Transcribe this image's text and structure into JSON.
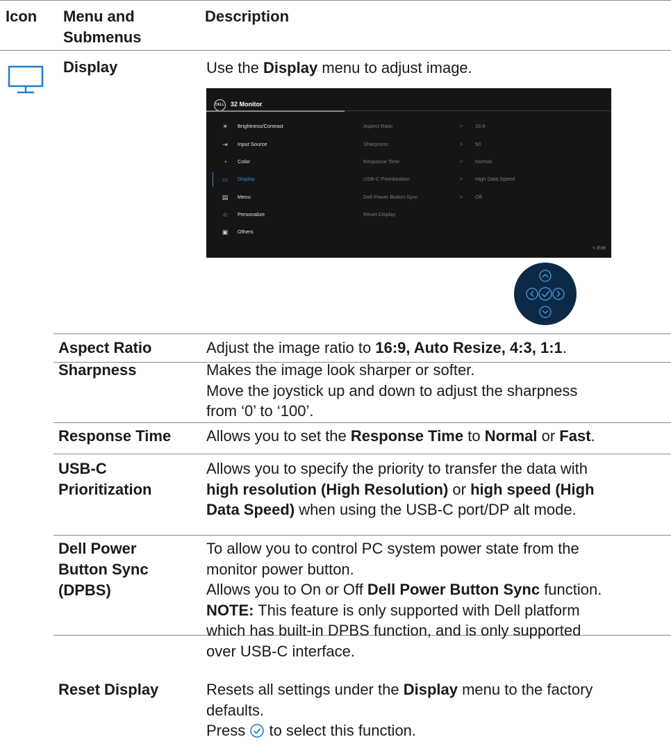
{
  "header": {
    "icon": "Icon",
    "menu_line1": "Menu and",
    "menu_line2": "Submenus",
    "description": "Description"
  },
  "main_menu": {
    "icon": "monitor-icon",
    "name": "Display",
    "desc_pre": "Use the ",
    "desc_bold": "Display",
    "desc_post": " menu to adjust image."
  },
  "osd": {
    "brand": "DELL",
    "title": "32 Monitor",
    "menu_items": [
      {
        "label": "Brightness/Contrast",
        "icon": "brightness-icon"
      },
      {
        "label": "Input Source",
        "icon": "input-source-icon"
      },
      {
        "label": "Color",
        "icon": "color-icon"
      },
      {
        "label": "Display",
        "icon": "display-icon"
      },
      {
        "label": "Menu",
        "icon": "menu-icon"
      },
      {
        "label": "Personalize",
        "icon": "star-icon"
      },
      {
        "label": "Others",
        "icon": "others-icon"
      }
    ],
    "active_index": 3,
    "submenu": [
      {
        "label": "Aspect Ratio",
        "arrow": ">",
        "value": "16:9"
      },
      {
        "label": "Sharpness",
        "arrow": ">",
        "value": "50"
      },
      {
        "label": "Response Time",
        "arrow": ">",
        "value": "Normal"
      },
      {
        "label": "USB-C Prioritization",
        "arrow": ">",
        "value": "High Data Speed"
      },
      {
        "label": "Dell Power Button Sync",
        "arrow": ">",
        "value": "Off"
      },
      {
        "label": "Reset Display",
        "arrow": "",
        "value": ""
      }
    ],
    "exit": "<  Exit",
    "accent": "#2d8fe0",
    "background": "#151515"
  },
  "joystick": {
    "background": "#0c2a45",
    "icons": [
      "up-icon",
      "left-icon",
      "check-icon",
      "right-icon",
      "down-icon"
    ]
  },
  "rows": {
    "aspect": {
      "name": "Aspect Ratio",
      "pre": "Adjust the image ratio to ",
      "bold": "16:9, Auto Resize, 4:3, 1:1",
      "post": "."
    },
    "sharpness": {
      "name": "Sharpness",
      "l1": "Makes the image look sharper or softer.",
      "l2": "Move the joystick up and down to adjust the sharpness",
      "l3": "from ‘0’ to ‘100’."
    },
    "response": {
      "name": "Response Time",
      "pre": "Allows you to set the ",
      "b1": "Response Time",
      "mid": " to ",
      "b2": "Normal",
      "or": " or ",
      "b3": "Fast",
      "post": "."
    },
    "usbc": {
      "name_l1": "USB-C",
      "name_l2": "Prioritization",
      "l1": "Allows you to specify the priority to transfer the data with",
      "b1": "high resolution (High Resolution)",
      "or": " or ",
      "b2a": "high speed (High",
      "b2b": "Data Speed)",
      "post": " when using the USB-C port/DP alt mode."
    },
    "dpbs": {
      "name_l1": "Dell Power",
      "name_l2": "Button Sync",
      "name_l3": "(DPBS)",
      "l1": "To allow you to control PC system power state from the",
      "l2": "monitor power button.",
      "l3_pre": "Allows you to On or Off ",
      "l3_bold": "Dell Power Button Sync",
      "l3_post": " function.",
      "note_bold": "NOTE:",
      "note_l1": " This feature is only supported with Dell platform",
      "note_l2": "which has built-in DPBS function, and is only supported",
      "note_l3": "over USB-C interface."
    },
    "reset": {
      "name": "Reset Display",
      "l1_pre": "Resets all settings under the ",
      "l1_bold": "Display",
      "l1_post": " menu to the factory",
      "l2": "defaults.",
      "l3_pre": "Press ",
      "l3_icon": "check-circle-icon",
      "l3_post": " to select this function."
    }
  }
}
